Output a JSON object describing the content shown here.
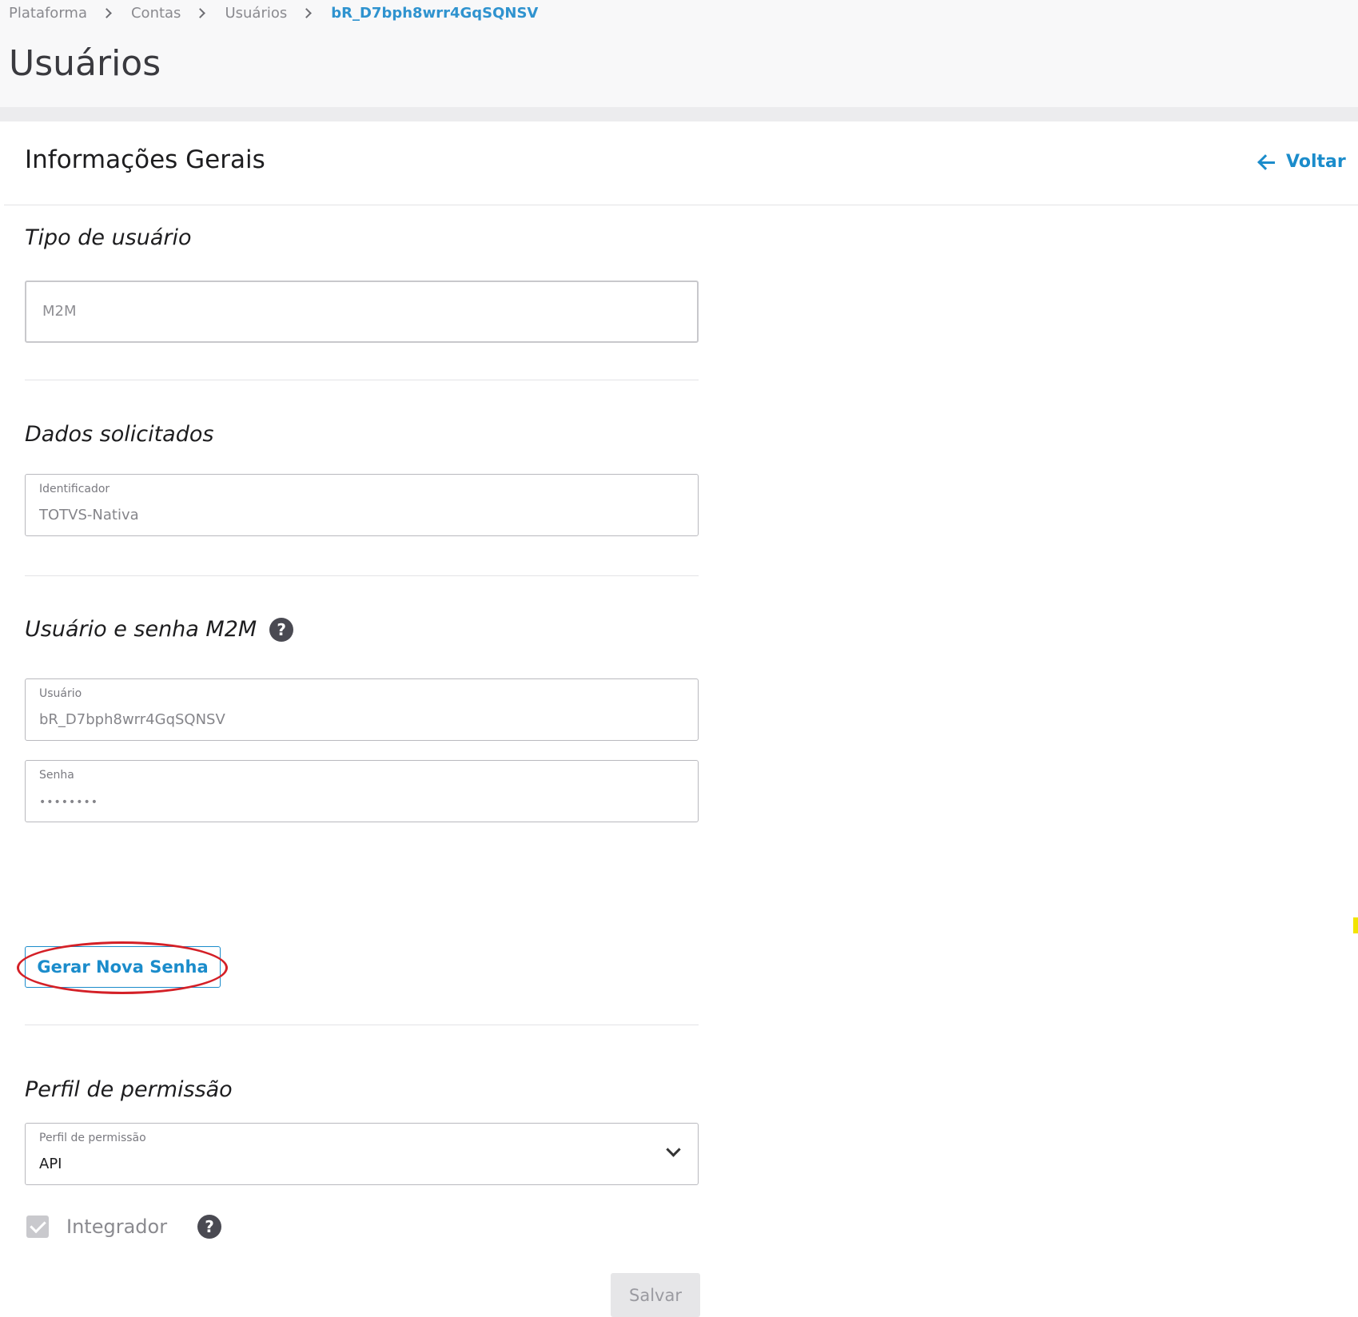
{
  "breadcrumb": {
    "items": [
      "Plataforma",
      "Contas",
      "Usuários"
    ],
    "current": "bR_D7bph8wrr4GqSQNSV"
  },
  "page": {
    "title": "Usuários"
  },
  "card": {
    "title": "Informações Gerais",
    "back_label": "Voltar"
  },
  "user_type": {
    "section_title": "Tipo de usuário",
    "value": "M2M"
  },
  "requested_data": {
    "section_title": "Dados solicitados",
    "identifier_label": "Identificador",
    "identifier_value": "TOTVS-Nativa"
  },
  "credentials": {
    "section_title": "Usuário e senha M2M",
    "user_label": "Usuário",
    "user_value": "bR_D7bph8wrr4GqSQNSV",
    "password_label": "Senha",
    "password_value": "••••••••",
    "generate_button": "Gerar Nova Senha"
  },
  "permission": {
    "section_title": "Perfil de permissão",
    "select_label": "Perfil de permissão",
    "select_value": "API",
    "integrator_label": "Integrador",
    "integrator_checked": true
  },
  "actions": {
    "save_label": "Salvar"
  },
  "colors": {
    "accent": "#1b8ccb",
    "highlight": "#d42027",
    "help_icon": "#4a4a52"
  },
  "icons": {
    "help": "?",
    "breadcrumb_separator": "chevron-right-icon",
    "back": "arrow-left-icon",
    "select": "chevron-down-icon",
    "checkbox": "checkmark-icon"
  }
}
